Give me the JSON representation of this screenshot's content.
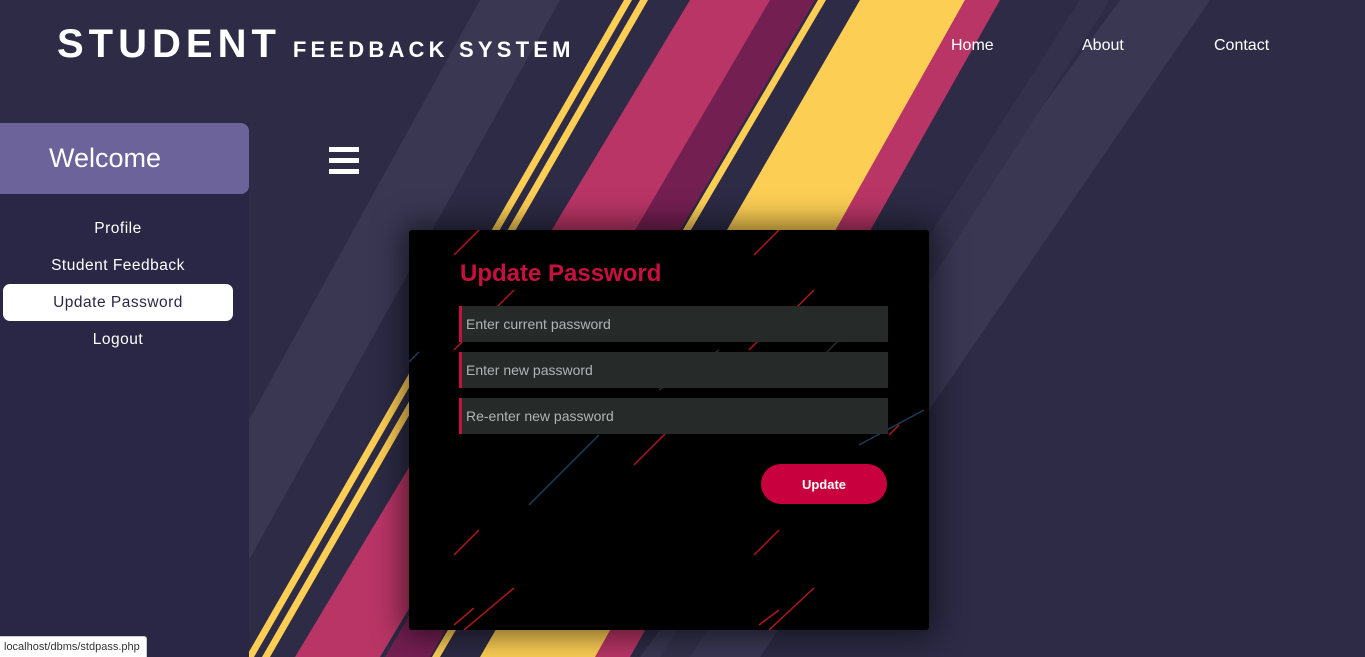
{
  "header": {
    "brand_main": "STUDENT",
    "brand_sub": "FEEDBACK SYSTEM",
    "nav": [
      {
        "label": "Home"
      },
      {
        "label": "About"
      },
      {
        "label": "Contact"
      }
    ]
  },
  "sidebar": {
    "welcome": "Welcome",
    "items": [
      {
        "label": "Profile"
      },
      {
        "label": "Student Feedback"
      },
      {
        "label": "Update Password",
        "active": true
      },
      {
        "label": "Logout"
      }
    ]
  },
  "form": {
    "title": "Update Password",
    "current_placeholder": "Enter current password",
    "new_placeholder": "Enter new password",
    "reenter_placeholder": "Re-enter new password",
    "submit_label": "Update"
  },
  "status_bar": {
    "url": "localhost/dbms/stdpass.php"
  },
  "colors": {
    "background": "#2d2b45",
    "sidebar": "#2a2645",
    "welcome_panel": "#6b6399",
    "accent_red": "#c8003d",
    "stripe_pink": "#b93566",
    "stripe_yellow": "#fdce54",
    "stripe_purple": "#741f52"
  },
  "icons": {
    "menu": "hamburger-icon"
  }
}
